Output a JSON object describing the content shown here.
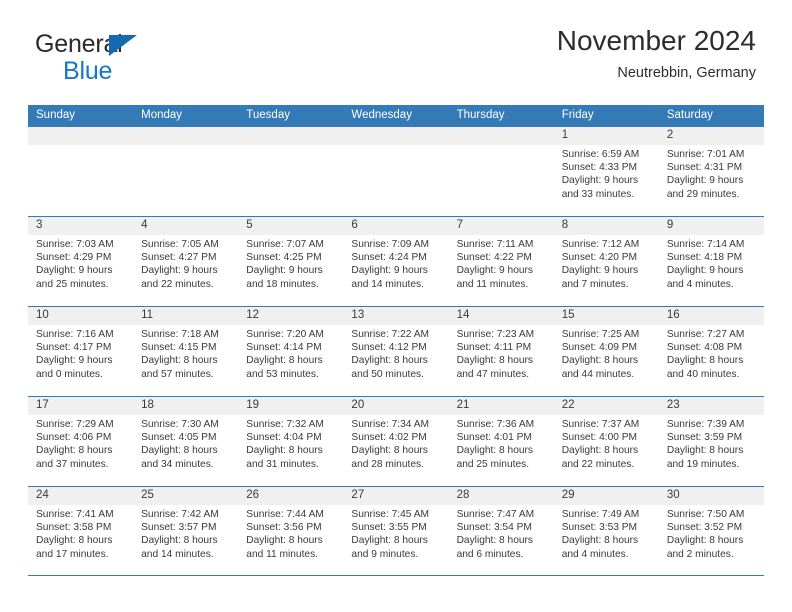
{
  "brand": {
    "name_part1": "General",
    "name_part2": "Blue",
    "triangle_color": "#1569b0",
    "blue_color": "#1777c4"
  },
  "header": {
    "title": "November 2024",
    "subtitle": "Neutrebbin, Germany"
  },
  "theme": {
    "header_row_bg": "#337ab7",
    "header_row_text": "#ffffff",
    "date_band_bg": "#f0f0f0",
    "row_divider": "#3a78b5",
    "body_text": "#3a3a3a"
  },
  "weekdays": [
    "Sunday",
    "Monday",
    "Tuesday",
    "Wednesday",
    "Thursday",
    "Friday",
    "Saturday"
  ],
  "weeks": [
    [
      {
        "day": "",
        "sunrise": "",
        "sunset": "",
        "daylight_line1": "",
        "daylight_line2": ""
      },
      {
        "day": "",
        "sunrise": "",
        "sunset": "",
        "daylight_line1": "",
        "daylight_line2": ""
      },
      {
        "day": "",
        "sunrise": "",
        "sunset": "",
        "daylight_line1": "",
        "daylight_line2": ""
      },
      {
        "day": "",
        "sunrise": "",
        "sunset": "",
        "daylight_line1": "",
        "daylight_line2": ""
      },
      {
        "day": "",
        "sunrise": "",
        "sunset": "",
        "daylight_line1": "",
        "daylight_line2": ""
      },
      {
        "day": "1",
        "sunrise": "Sunrise: 6:59 AM",
        "sunset": "Sunset: 4:33 PM",
        "daylight_line1": "Daylight: 9 hours",
        "daylight_line2": "and 33 minutes."
      },
      {
        "day": "2",
        "sunrise": "Sunrise: 7:01 AM",
        "sunset": "Sunset: 4:31 PM",
        "daylight_line1": "Daylight: 9 hours",
        "daylight_line2": "and 29 minutes."
      }
    ],
    [
      {
        "day": "3",
        "sunrise": "Sunrise: 7:03 AM",
        "sunset": "Sunset: 4:29 PM",
        "daylight_line1": "Daylight: 9 hours",
        "daylight_line2": "and 25 minutes."
      },
      {
        "day": "4",
        "sunrise": "Sunrise: 7:05 AM",
        "sunset": "Sunset: 4:27 PM",
        "daylight_line1": "Daylight: 9 hours",
        "daylight_line2": "and 22 minutes."
      },
      {
        "day": "5",
        "sunrise": "Sunrise: 7:07 AM",
        "sunset": "Sunset: 4:25 PM",
        "daylight_line1": "Daylight: 9 hours",
        "daylight_line2": "and 18 minutes."
      },
      {
        "day": "6",
        "sunrise": "Sunrise: 7:09 AM",
        "sunset": "Sunset: 4:24 PM",
        "daylight_line1": "Daylight: 9 hours",
        "daylight_line2": "and 14 minutes."
      },
      {
        "day": "7",
        "sunrise": "Sunrise: 7:11 AM",
        "sunset": "Sunset: 4:22 PM",
        "daylight_line1": "Daylight: 9 hours",
        "daylight_line2": "and 11 minutes."
      },
      {
        "day": "8",
        "sunrise": "Sunrise: 7:12 AM",
        "sunset": "Sunset: 4:20 PM",
        "daylight_line1": "Daylight: 9 hours",
        "daylight_line2": "and 7 minutes."
      },
      {
        "day": "9",
        "sunrise": "Sunrise: 7:14 AM",
        "sunset": "Sunset: 4:18 PM",
        "daylight_line1": "Daylight: 9 hours",
        "daylight_line2": "and 4 minutes."
      }
    ],
    [
      {
        "day": "10",
        "sunrise": "Sunrise: 7:16 AM",
        "sunset": "Sunset: 4:17 PM",
        "daylight_line1": "Daylight: 9 hours",
        "daylight_line2": "and 0 minutes."
      },
      {
        "day": "11",
        "sunrise": "Sunrise: 7:18 AM",
        "sunset": "Sunset: 4:15 PM",
        "daylight_line1": "Daylight: 8 hours",
        "daylight_line2": "and 57 minutes."
      },
      {
        "day": "12",
        "sunrise": "Sunrise: 7:20 AM",
        "sunset": "Sunset: 4:14 PM",
        "daylight_line1": "Daylight: 8 hours",
        "daylight_line2": "and 53 minutes."
      },
      {
        "day": "13",
        "sunrise": "Sunrise: 7:22 AM",
        "sunset": "Sunset: 4:12 PM",
        "daylight_line1": "Daylight: 8 hours",
        "daylight_line2": "and 50 minutes."
      },
      {
        "day": "14",
        "sunrise": "Sunrise: 7:23 AM",
        "sunset": "Sunset: 4:11 PM",
        "daylight_line1": "Daylight: 8 hours",
        "daylight_line2": "and 47 minutes."
      },
      {
        "day": "15",
        "sunrise": "Sunrise: 7:25 AM",
        "sunset": "Sunset: 4:09 PM",
        "daylight_line1": "Daylight: 8 hours",
        "daylight_line2": "and 44 minutes."
      },
      {
        "day": "16",
        "sunrise": "Sunrise: 7:27 AM",
        "sunset": "Sunset: 4:08 PM",
        "daylight_line1": "Daylight: 8 hours",
        "daylight_line2": "and 40 minutes."
      }
    ],
    [
      {
        "day": "17",
        "sunrise": "Sunrise: 7:29 AM",
        "sunset": "Sunset: 4:06 PM",
        "daylight_line1": "Daylight: 8 hours",
        "daylight_line2": "and 37 minutes."
      },
      {
        "day": "18",
        "sunrise": "Sunrise: 7:30 AM",
        "sunset": "Sunset: 4:05 PM",
        "daylight_line1": "Daylight: 8 hours",
        "daylight_line2": "and 34 minutes."
      },
      {
        "day": "19",
        "sunrise": "Sunrise: 7:32 AM",
        "sunset": "Sunset: 4:04 PM",
        "daylight_line1": "Daylight: 8 hours",
        "daylight_line2": "and 31 minutes."
      },
      {
        "day": "20",
        "sunrise": "Sunrise: 7:34 AM",
        "sunset": "Sunset: 4:02 PM",
        "daylight_line1": "Daylight: 8 hours",
        "daylight_line2": "and 28 minutes."
      },
      {
        "day": "21",
        "sunrise": "Sunrise: 7:36 AM",
        "sunset": "Sunset: 4:01 PM",
        "daylight_line1": "Daylight: 8 hours",
        "daylight_line2": "and 25 minutes."
      },
      {
        "day": "22",
        "sunrise": "Sunrise: 7:37 AM",
        "sunset": "Sunset: 4:00 PM",
        "daylight_line1": "Daylight: 8 hours",
        "daylight_line2": "and 22 minutes."
      },
      {
        "day": "23",
        "sunrise": "Sunrise: 7:39 AM",
        "sunset": "Sunset: 3:59 PM",
        "daylight_line1": "Daylight: 8 hours",
        "daylight_line2": "and 19 minutes."
      }
    ],
    [
      {
        "day": "24",
        "sunrise": "Sunrise: 7:41 AM",
        "sunset": "Sunset: 3:58 PM",
        "daylight_line1": "Daylight: 8 hours",
        "daylight_line2": "and 17 minutes."
      },
      {
        "day": "25",
        "sunrise": "Sunrise: 7:42 AM",
        "sunset": "Sunset: 3:57 PM",
        "daylight_line1": "Daylight: 8 hours",
        "daylight_line2": "and 14 minutes."
      },
      {
        "day": "26",
        "sunrise": "Sunrise: 7:44 AM",
        "sunset": "Sunset: 3:56 PM",
        "daylight_line1": "Daylight: 8 hours",
        "daylight_line2": "and 11 minutes."
      },
      {
        "day": "27",
        "sunrise": "Sunrise: 7:45 AM",
        "sunset": "Sunset: 3:55 PM",
        "daylight_line1": "Daylight: 8 hours",
        "daylight_line2": "and 9 minutes."
      },
      {
        "day": "28",
        "sunrise": "Sunrise: 7:47 AM",
        "sunset": "Sunset: 3:54 PM",
        "daylight_line1": "Daylight: 8 hours",
        "daylight_line2": "and 6 minutes."
      },
      {
        "day": "29",
        "sunrise": "Sunrise: 7:49 AM",
        "sunset": "Sunset: 3:53 PM",
        "daylight_line1": "Daylight: 8 hours",
        "daylight_line2": "and 4 minutes."
      },
      {
        "day": "30",
        "sunrise": "Sunrise: 7:50 AM",
        "sunset": "Sunset: 3:52 PM",
        "daylight_line1": "Daylight: 8 hours",
        "daylight_line2": "and 2 minutes."
      }
    ]
  ]
}
